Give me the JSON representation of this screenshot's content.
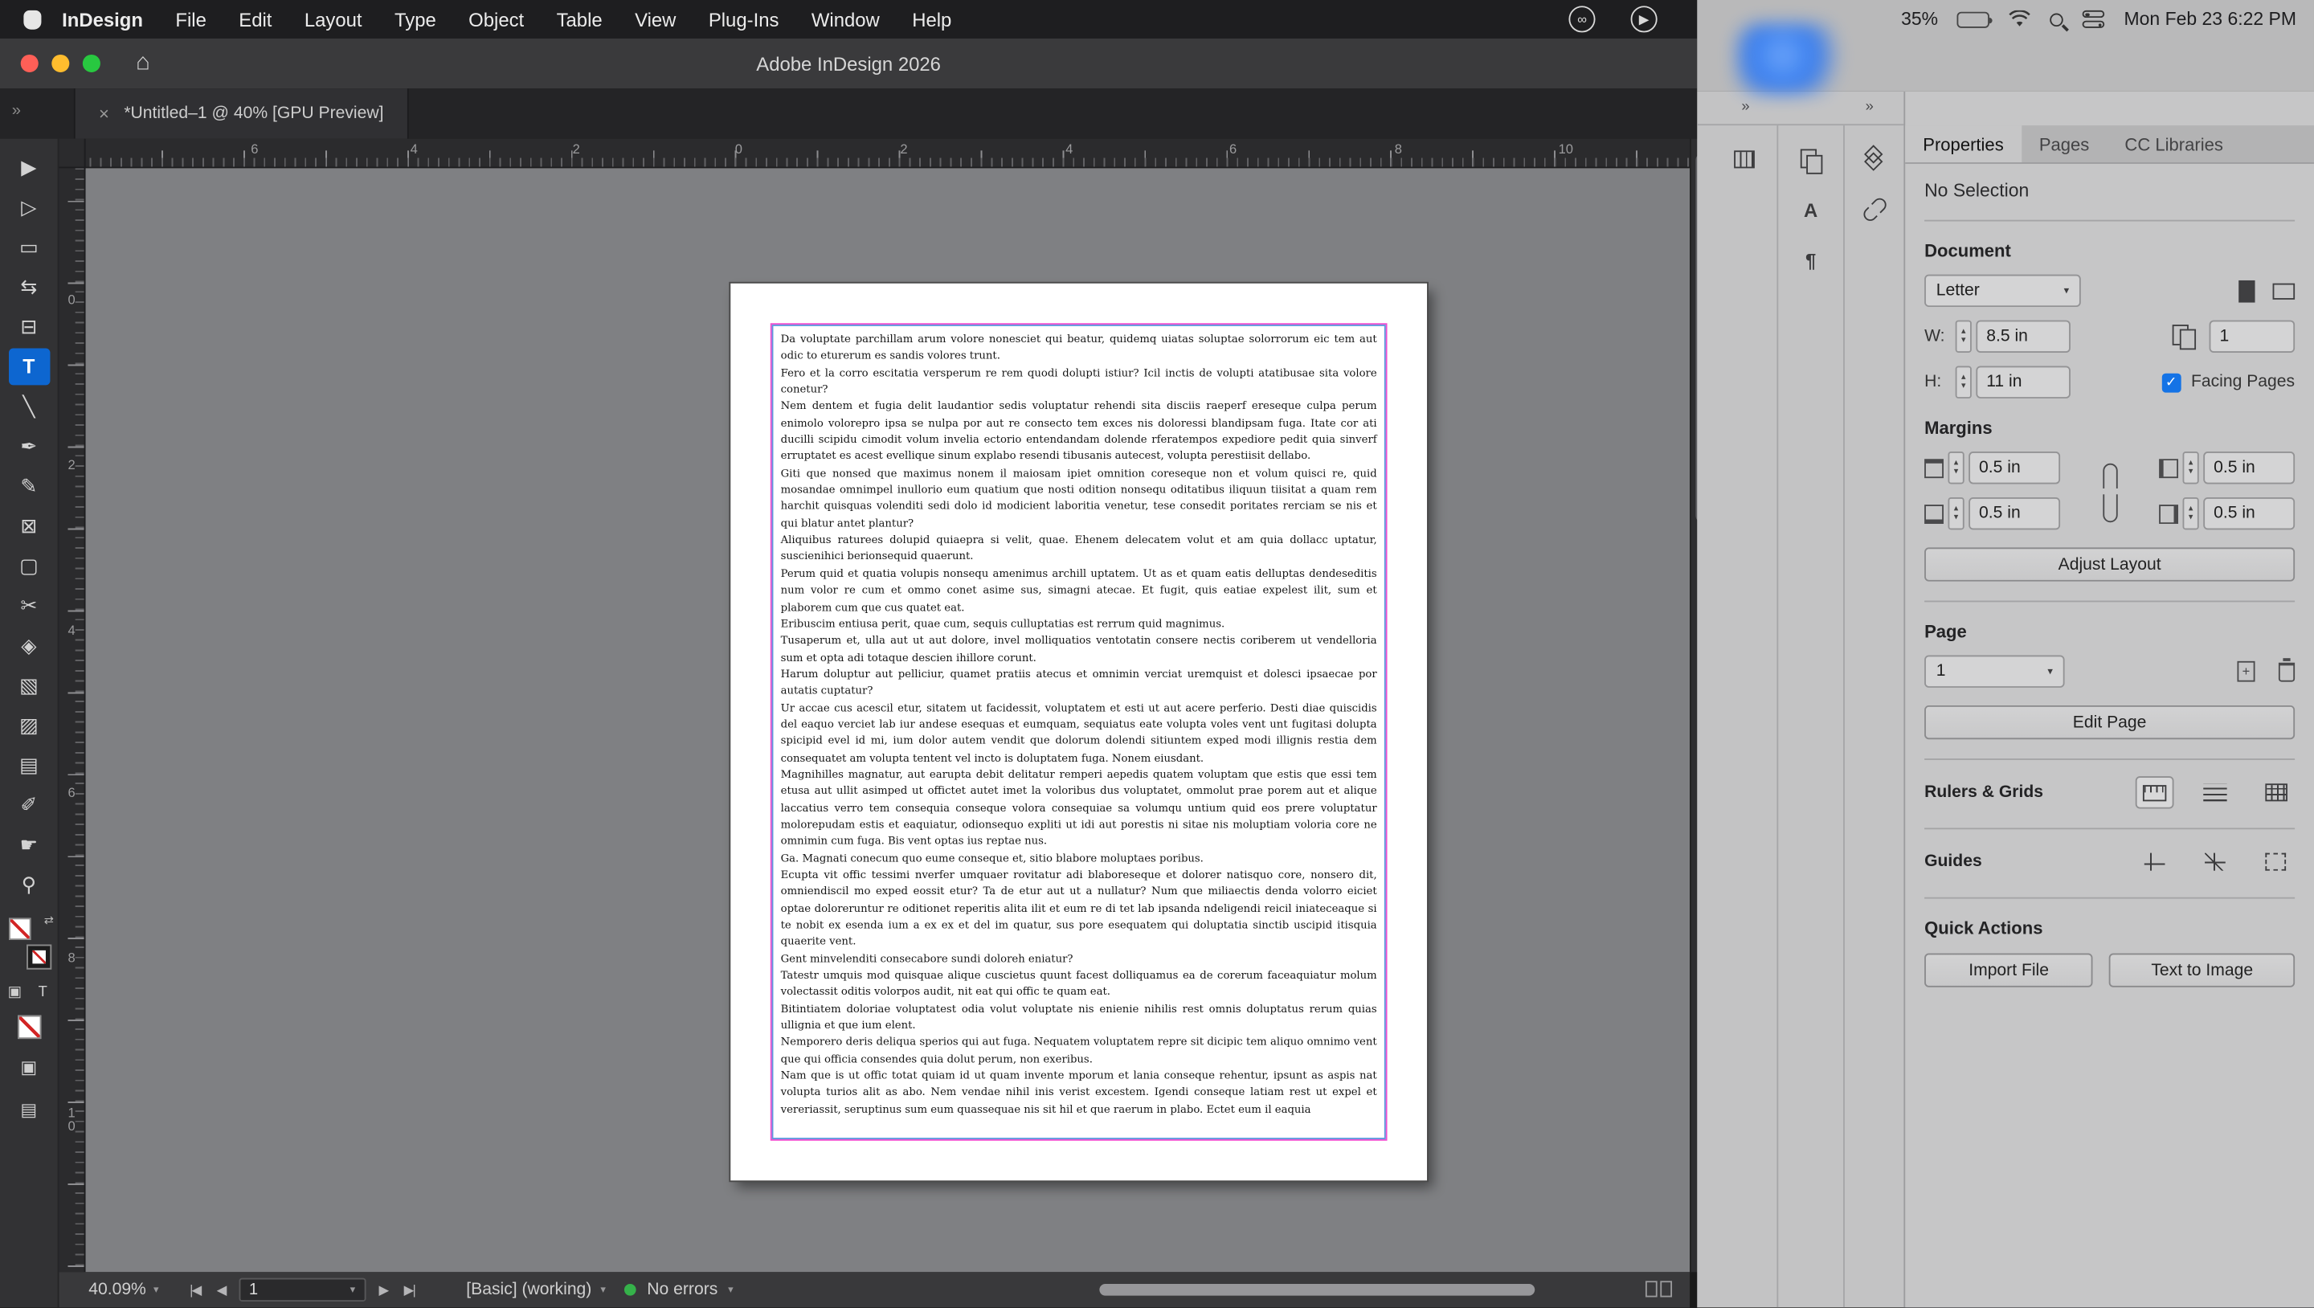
{
  "menubar": {
    "items": [
      "InDesign",
      "File",
      "Edit",
      "Layout",
      "Type",
      "Object",
      "Table",
      "View",
      "Plug-Ins",
      "Window",
      "Help"
    ],
    "battery": "35%",
    "clock": "Mon Feb 23  6:22 PM"
  },
  "titlebar": {
    "title": "Adobe InDesign 2026"
  },
  "tabbar": {
    "active_tab": "*Untitled–1 @ 40% [GPU Preview]"
  },
  "rulers": {
    "horizontal": [
      "6",
      "4",
      "2",
      "0",
      "2",
      "4",
      "6",
      "8",
      "10"
    ],
    "vertical": [
      "0",
      "2",
      "4",
      "6",
      "8",
      "1\n0"
    ]
  },
  "toolbar": {
    "selected_tool": "type",
    "tools": [
      "selection",
      "direct-selection",
      "page",
      "gap",
      "content-collector",
      "type",
      "line",
      "pen",
      "pencil",
      "rectangle-frame",
      "rectangle",
      "scissors",
      "free-transform",
      "gradient-swatch",
      "gradient-feather",
      "note",
      "eyedropper",
      "hand",
      "zoom"
    ]
  },
  "document": {
    "paragraphs": [
      "Da voluptate parchillam arum volore nonesciet qui beatur, quidemq uiatas soluptae solorrorum eic tem aut odic to eturerum es sandis volores trunt.",
      "Fero et la corro escitatia versperum re rem quodi dolupti istiur? Icil inctis de volupti atatibusae sita volore conetur?",
      "Nem dentem et fugia delit laudantior sedis voluptatur rehendi sita disciis raeperf ereseque culpa perum enimolo volorepro ipsa se nulpa por aut re consecto tem exces nis doloressi blandipsam fuga. Itate cor ati ducilli scipidu cimodit volum invelia ectorio entendandam dolende rferatempos expediore pedit quia sinverf erruptatet es acest evellique sinum explabo resendi tibusanis autecest, volupta perestiisit dellabo.",
      "Giti que nonsed que maximus nonem il maiosam ipiet omnition coreseque non et volum quisci re, quid mosandae omnimpel inullorio eum quatium que nosti odition nonsequ oditatibus iliquun tiisitat a quam rem harchit quisquas volenditi sedi dolo id modicient laboritia venetur, tese consedit poritates rerciam se nis et qui blatur antet plantur?",
      "Aliquibus raturees dolupid quiaepra si velit, quae. Ehenem delecatem volut et am quia dollacc uptatur, suscienihici berionsequid quaerunt.",
      "Perum quid et quatia volupis nonsequ amenimus archill uptatem. Ut as et quam eatis delluptas dendeseditis num volor re cum et ommo conet asime sus, simagni atecae. Et fugit, quis eatiae expelest ilit, sum et plaborem cum que cus quatet eat.",
      "Eribuscim entiusa perit, quae cum, sequis culluptatias est rerrum quid magnimus.",
      "Tusaperum et, ulla aut ut aut dolore, invel molliquatios ventotatin consere nectis coriberem ut vendelloria sum et opta adi totaque descien ihillore corunt.",
      "Harum doluptur aut pelliciur, quamet pratiis atecus et omnimin verciat uremquist et dolesci ipsaecae por autatis cuptatur?",
      "Ur accae cus acescil etur, sitatem ut facidessit, voluptatem et esti ut aut acere perferio. Desti diae quiscidis del eaquo verciet lab iur andese esequas et eumquam, sequiatus eate volupta voles vent unt fugitasi dolupta spicipid evel id mi, ium dolor autem vendit que dolorum dolendi sitiuntem exped modi illignis restia dem consequatet am volupta tentent vel incto is doluptatem fuga. Nonem eiusdant.",
      "Magnihilles magnatur, aut earupta debit delitatur remperi aepedis quatem voluptam que estis que essi tem etusa aut ullit asimped ut offictet autet imet la voloribus dus voluptatet, ommolut prae porem aut et alique laccatius verro tem consequia conseque volora consequiae sa volumqu untium quid eos prere voluptatur molorepudam estis et eaquiatur, odionsequo expliti ut idi aut porestis ni sitae nis moluptiam voloria core ne omnimin cum fuga. Bis vent optas ius reptae nus.",
      "Ga. Magnati conecum quo eume conseque et, sitio blabore moluptaes poribus.",
      "Ecupta vit offic tessimi nverfer umquaer rovitatur adi blaboreseque et dolorer natisquo core, nonsero dit, omniendiscil mo exped eossit etur? Ta de etur aut ut a nullatur? Num que miliaectis denda volorro eiciet optae doloreruntur re oditionet reperitis alita ilit et eum re di tet lab ipsanda ndeligendi reicil iniateceaque si te nobit ex esenda ium a ex ex et del im quatur, sus pore esequatem qui doluptatia sinctib uscipid itisquia quaerite vent.",
      "Gent minvelenditi consecabore sundi doloreh eniatur?",
      "Tatestr umquis mod quisquae alique cuscietus quunt facest dolliquamus ea de corerum faceaquiatur molum volectassit oditis volorpos audit, nit eat qui offic te quam eat.",
      "Bitintiatem doloriae voluptatest odia volut voluptate nis enienie nihilis rest omnis doluptatus rerum quias ullignia et que ium elent.",
      "Nemporero deris deliqua sperios qui aut fuga. Nequatem voluptatem repre sit dicipic tem aliquo omnimo vent que qui officia consendes quia dolut perum, non exeribus.",
      "Nam que is ut offic totat quiam id ut quam invente mporum et lania conseque rehentur, ipsunt as aspis nat volupta turios alit as abo. Nem vendae nihil inis verist excestem. Igendi conseque latiam rest ut expel et vereriassit, seruptinus sum eum quassequae nis sit hil et que raerum in plabo. Ectet eum il eaquia"
    ]
  },
  "panels": {
    "tabs": [
      "Properties",
      "Pages",
      "CC Libraries"
    ],
    "active_tab": "Properties",
    "selection_status": "No Selection",
    "document": {
      "heading": "Document",
      "page_size": "Letter",
      "w_label": "W:",
      "w_value": "8.5 in",
      "h_label": "H:",
      "h_value": "11 in",
      "pages_count": "1",
      "facing_pages_label": "Facing Pages",
      "facing_pages_checked": true
    },
    "margins": {
      "heading": "Margins",
      "top": "0.5 in",
      "bottom": "0.5 in",
      "left": "0.5 in",
      "right": "0.5 in"
    },
    "adjust_layout_label": "Adjust Layout",
    "page": {
      "heading": "Page",
      "current_page": "1",
      "edit_page_label": "Edit Page"
    },
    "rulers_grids_label": "Rulers & Grids",
    "guides_label": "Guides",
    "quick_actions": {
      "heading": "Quick Actions",
      "import_file_label": "Import File",
      "text_to_image_label": "Text to Image"
    }
  },
  "statusbar": {
    "zoom": "40.09%",
    "page_field": "1",
    "preflight": "[Basic] (working)",
    "errors": "No errors"
  }
}
